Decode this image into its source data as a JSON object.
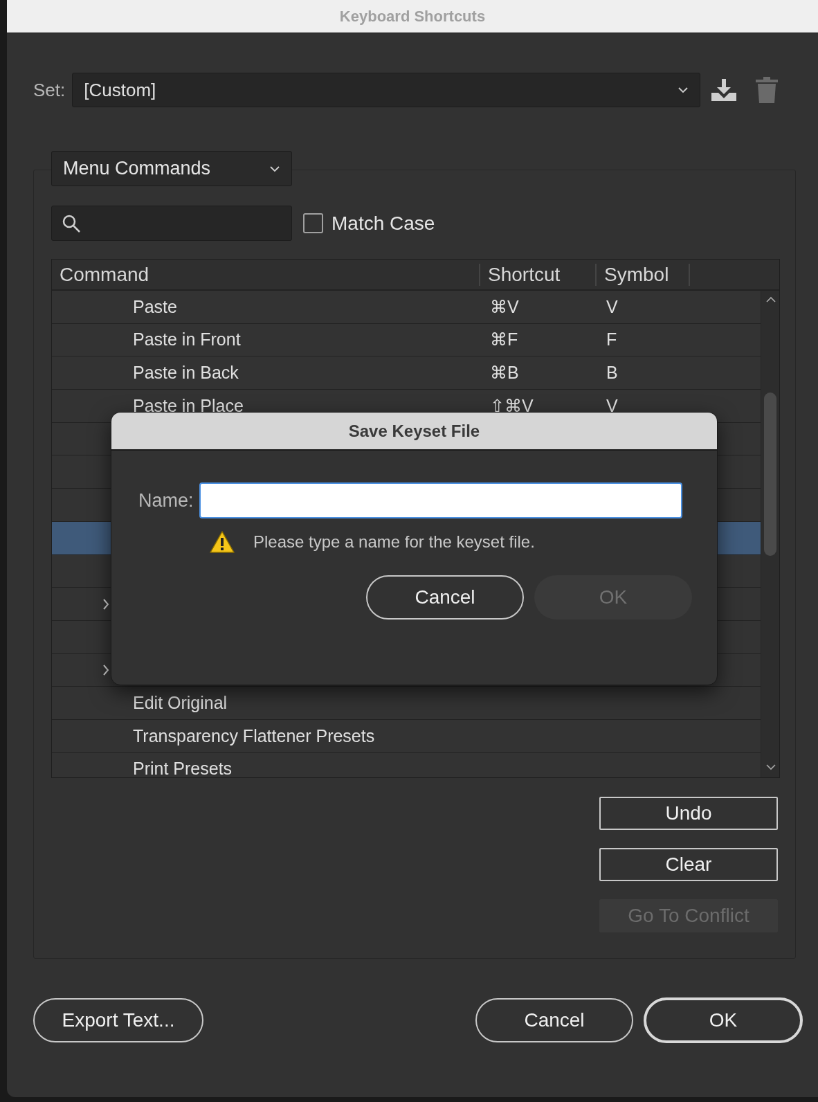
{
  "window": {
    "title": "Keyboard Shortcuts"
  },
  "set": {
    "label": "Set:",
    "value": "[Custom]"
  },
  "product_area": {
    "value": "Menu Commands"
  },
  "match_case": {
    "label": "Match Case",
    "checked": false
  },
  "table": {
    "columns": [
      "Command",
      "Shortcut",
      "Symbol"
    ],
    "rows": [
      {
        "command": "Paste",
        "shortcut": "⌘V",
        "symbol": "V",
        "selected": false,
        "expandable": false
      },
      {
        "command": "Paste in Front",
        "shortcut": "⌘F",
        "symbol": "F",
        "selected": false,
        "expandable": false
      },
      {
        "command": "Paste in Back",
        "shortcut": "⌘B",
        "symbol": "B",
        "selected": false,
        "expandable": false
      },
      {
        "command": "Paste in Place",
        "shortcut": "⇧⌘V",
        "symbol": "V",
        "selected": false,
        "expandable": false
      },
      {
        "selected": false,
        "expandable": false
      },
      {
        "selected": false,
        "expandable": false
      },
      {
        "selected": false,
        "expandable": false
      },
      {
        "selected": true,
        "expandable": false
      },
      {
        "selected": false,
        "expandable": false
      },
      {
        "selected": false,
        "expandable": true
      },
      {
        "selected": false,
        "expandable": false
      },
      {
        "selected": false,
        "expandable": true
      },
      {
        "command": "Edit Original",
        "selected": false,
        "expandable": false
      },
      {
        "command": "Transparency Flattener Presets",
        "selected": false,
        "expandable": false
      },
      {
        "command": "Print Presets",
        "selected": false,
        "expandable": false
      }
    ]
  },
  "side_buttons": [
    {
      "label": "Undo",
      "disabled": false
    },
    {
      "label": "Clear",
      "disabled": false
    },
    {
      "label": "Go To Conflict",
      "disabled": true
    }
  ],
  "footer": {
    "export": "Export Text...",
    "cancel": "Cancel",
    "ok": "OK"
  },
  "dialog": {
    "title": "Save Keyset File",
    "name_label": "Name:",
    "warning": "Please type a name for the keyset file.",
    "buttons": [
      {
        "label": "Cancel",
        "disabled": false
      },
      {
        "label": "OK",
        "disabled": true
      }
    ]
  }
}
